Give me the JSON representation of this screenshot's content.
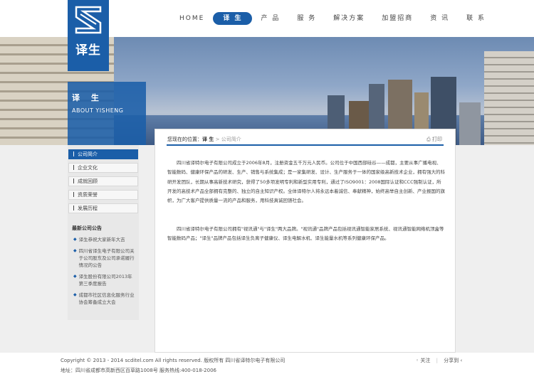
{
  "brand": {
    "name": "译生"
  },
  "nav": [
    "HOME",
    "译 生",
    "产 品",
    "服 务",
    "解决方案",
    "加盟招商",
    "资 讯",
    "联 系"
  ],
  "banner": {
    "title": "译 生",
    "subtitle": "ABOUT YISHENG"
  },
  "sidebar": {
    "items": [
      "公司简介",
      "企业文化",
      "成就回顾",
      "资质荣誉",
      "发展历程"
    ],
    "news_title": "最新公司公告",
    "news": [
      "译生恭祝大家新年大吉",
      "四川省译生电子有限公司关于公司股东及公司承诺履行情况的公告",
      "译生股份有限公司2013年第三季度报告",
      "成都市社区信息化服务行业协会筹备成立大会"
    ]
  },
  "breadcrumb": {
    "prefix": "您现在的位置：",
    "section": "译 生",
    "sep": " > ",
    "page": "公司简介"
  },
  "print_label": "打印",
  "content": {
    "paragraphs": [
      "四川省译特尔电子有限公司成立于2006年8月，注册资金五千万元人民币。公司位于中国西部硅谷——成都，主要从事广播电视、智能数码、健康环保产品的研发、生产、销售与系统集成；是一家集研发、设计、生产服务于一体的国家级高新技术企业，拥有强大的科研开发团队，长期从事高新技术研究，获得了50多项发明专利和新型实用专利，通过了ISO9001：2008国际认证和CCC强制认证，所开发的高技术产品全部拥有完整的、独立的自主知识产权。全体译特尔人将永远本着诚信、奉献精神，始终高举自主创新、产业报国的旗帜，为广大客户提供质量一流的产品和服务，用科技真诚回馈社会。",
      "四川省译特尔电子有限公司拥有\"视讯通\"与\"译生\"两大品牌。\"视讯通\"品牌产品包括视讯通智能家居系统、视讯通智能网络机顶盒等智能数码产品；\"译生\"品牌产品包括译生负离子健康仪、译生电解水机、译生能量水机等系列健康环保产品。"
    ]
  },
  "footer": {
    "copyright": "Copyright © 2013 - 2014 scditel.com All rights reserved. 版权所有 四川省译特尔电子有限公司",
    "address": "地址：四川省成都市高新西区百草路1008号   服务热线:400-018-2006",
    "links": [
      "关注",
      "分享到"
    ]
  },
  "colors": {
    "accent": "#1b5ea8"
  }
}
